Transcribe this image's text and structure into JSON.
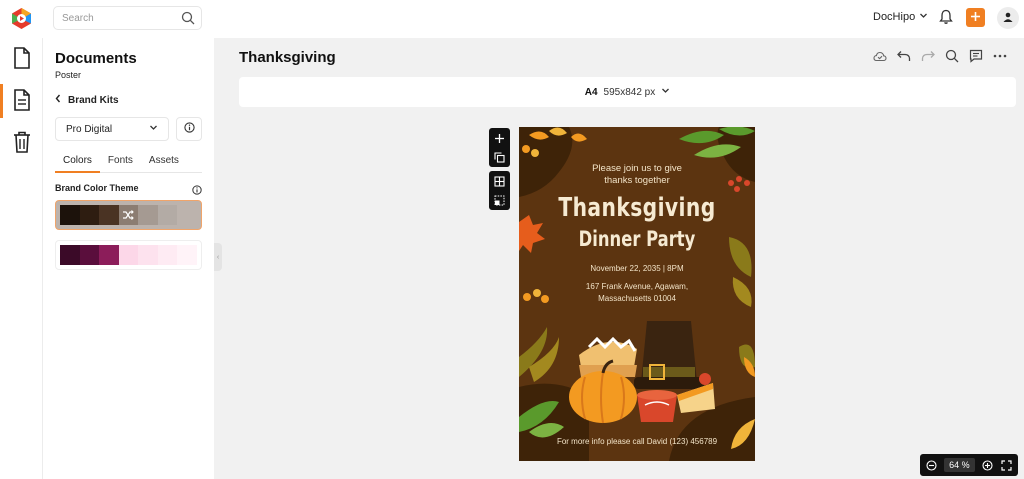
{
  "header": {
    "search_placeholder": "Search",
    "account_name": "DocHipo",
    "icons": [
      "logo-icon",
      "search-icon",
      "chevron-down-icon",
      "bell-icon",
      "plus-icon",
      "user-icon"
    ]
  },
  "rail": {
    "items": [
      {
        "icon": "document-icon"
      },
      {
        "icon": "template-document-icon",
        "active": true
      },
      {
        "icon": "trash-icon"
      }
    ]
  },
  "panel": {
    "title": "Documents",
    "subtitle": "Poster",
    "back_label": "Brand Kits",
    "kit_selected": "Pro Digital",
    "tabs": [
      {
        "label": "Colors",
        "active": true
      },
      {
        "label": "Fonts",
        "active": false
      },
      {
        "label": "Assets",
        "active": false
      }
    ],
    "theme_title": "Brand Color Theme",
    "palettes": [
      {
        "colors": [
          "#1c120b",
          "#2e1d11",
          "#4a3323",
          "#8c7d72",
          "#a59a92",
          "#b3aba5",
          "#bcb3ad"
        ],
        "selected": true
      },
      {
        "colors": [
          "#3b0a28",
          "#5a0e3c",
          "#8c1d5a",
          "#fcd7e8",
          "#fde2ee",
          "#feebf3",
          "#fff3f8"
        ],
        "selected": false
      }
    ]
  },
  "main": {
    "doc_title": "Thanksgiving",
    "size_label": "A4",
    "size_value": "595x842 px",
    "zoom": "64 %"
  },
  "poster": {
    "join_line1": "Please join us to give",
    "join_line2": "thanks together",
    "heading1": "Thanksgiving",
    "heading2": "Dinner Party",
    "date": "November 22, 2035 | 8PM",
    "address_line1": "167 Frank Avenue, Agawam,",
    "address_line2": "Massachusetts 01004",
    "footer": "For more info please call David (123) 456789",
    "colors": {
      "background": "#5c3410",
      "accent": "#f39a21",
      "leaf_green": "#5a9a2c",
      "text": "#f3e4c8"
    }
  }
}
